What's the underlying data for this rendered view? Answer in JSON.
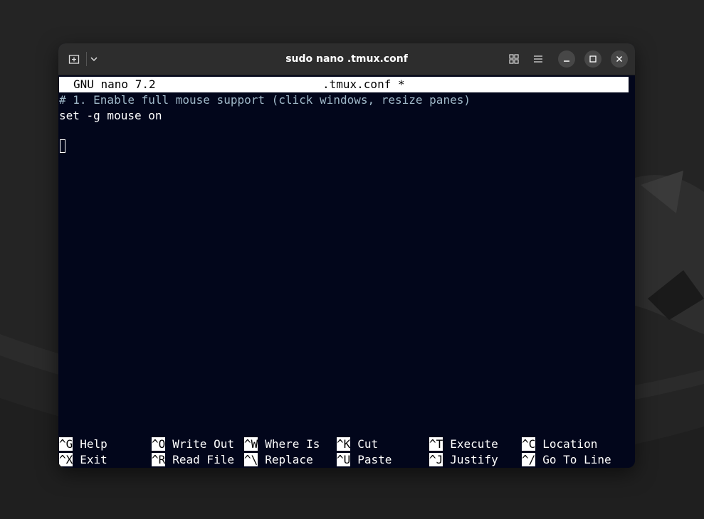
{
  "window": {
    "title": "sudo nano .tmux.conf"
  },
  "nano": {
    "version": "GNU nano 7.2",
    "filename": ".tmux.conf *",
    "lines": [
      "# 1. Enable full mouse support (click windows, resize panes)",
      "set -g mouse on"
    ]
  },
  "shortcuts": [
    {
      "key": "^G",
      "label": "Help"
    },
    {
      "key": "^O",
      "label": "Write Out"
    },
    {
      "key": "^W",
      "label": "Where Is"
    },
    {
      "key": "^K",
      "label": "Cut"
    },
    {
      "key": "^T",
      "label": "Execute"
    },
    {
      "key": "^C",
      "label": "Location"
    },
    {
      "key": "^X",
      "label": "Exit"
    },
    {
      "key": "^R",
      "label": "Read File"
    },
    {
      "key": "^\\",
      "label": "Replace"
    },
    {
      "key": "^U",
      "label": "Paste"
    },
    {
      "key": "^J",
      "label": "Justify"
    },
    {
      "key": "^/",
      "label": "Go To Line"
    }
  ],
  "colors": {
    "terminal_bg": "#02061b",
    "titlebar_bg": "#2d2d2d",
    "comment": "#9fb8c8"
  },
  "icons": {
    "new_tab": "new-tab-icon",
    "dropdown": "chevron-down-icon",
    "grid": "grid-view-icon",
    "menu": "hamburger-menu-icon",
    "minimize": "minimize-icon",
    "maximize": "maximize-icon",
    "close": "close-icon"
  }
}
